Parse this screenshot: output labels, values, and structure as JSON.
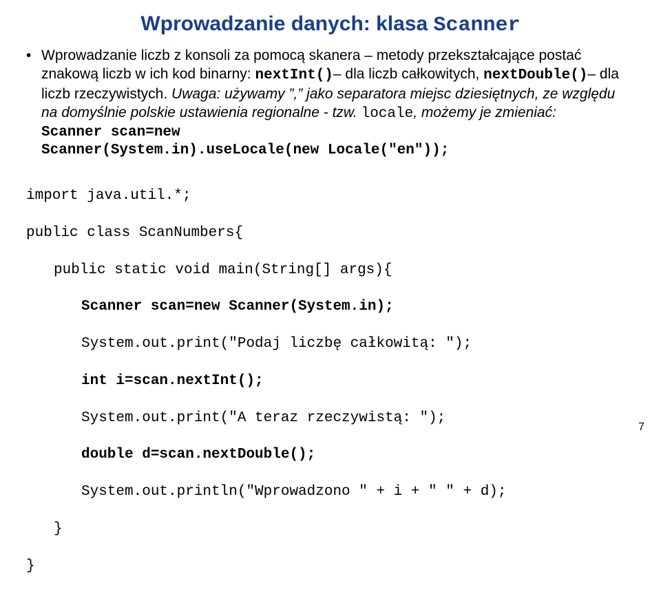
{
  "title": {
    "pre": "Wprowadzanie danych: klasa ",
    "code": "Scanner"
  },
  "bullet": {
    "t1": "Wprowadzanie liczb z konsoli za pomocą skanera – metody przekształcające postać znakową liczb w ich kod binarny: ",
    "c1": "nextInt()",
    "t2": "– dla liczb całkowitych, ",
    "c2": "nextDouble()",
    "t3": "– dla liczb rzeczywistych. ",
    "i1": "Uwaga: używamy ”,” jako separatora miejsc dziesiętnych, ze względu na domyślnie polskie ustawienia regionalne - tzw. ",
    "c3": "locale",
    "i2": ", możemy je zmieniać:",
    "cb1": "Scanner scan=new",
    "cb2": "Scanner(System.in).useLocale(new Locale(″en″));"
  },
  "code": {
    "l1": "import java.util.*;",
    "l2": "public class ScanNumbers{",
    "l3": "public static void main(String[] args){",
    "l4": "Scanner scan=new Scanner(System.in);",
    "l5": "System.out.print(″Podaj liczbę całkowitą: ″);",
    "l6": "int i=scan.nextInt();",
    "l7": "System.out.print(″A teraz rzeczywistą: ″);",
    "l8": "double d=scan.nextDouble();",
    "l9": "System.out.println(″Wprowadzono ″ + i + ″ ″ + d);",
    "l10": "}",
    "l11": "}"
  },
  "page": "7"
}
